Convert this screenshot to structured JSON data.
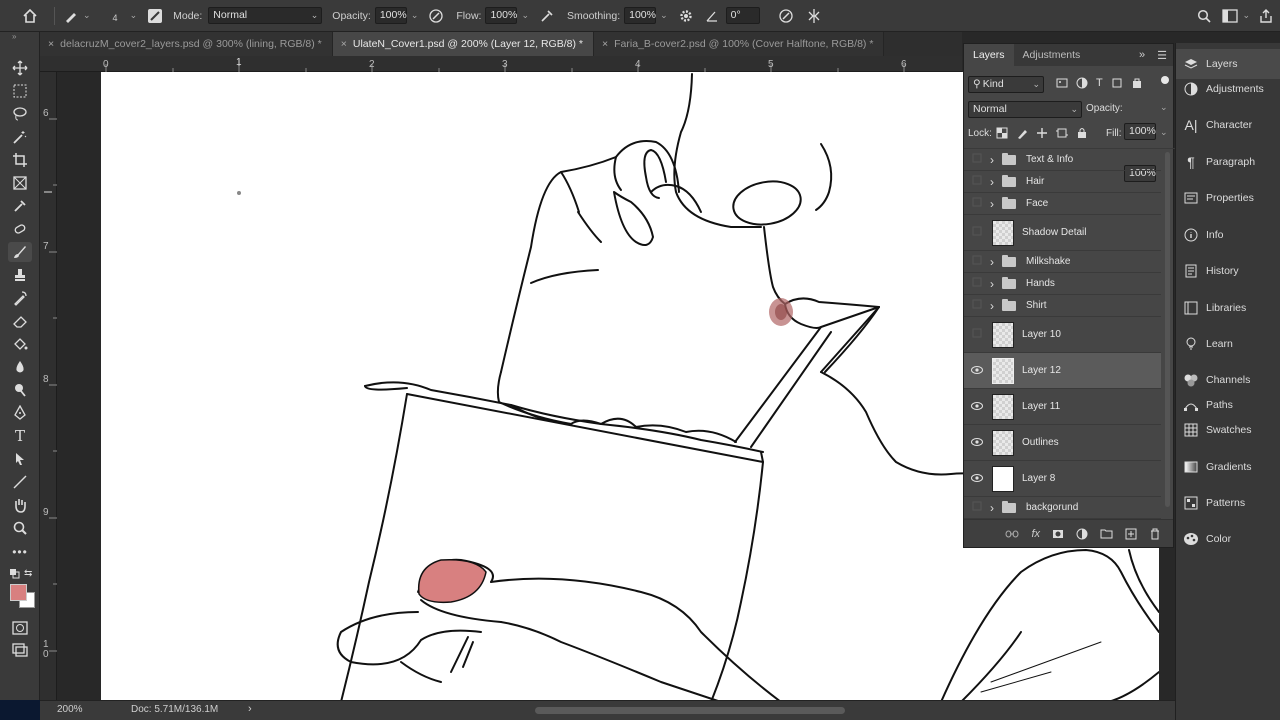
{
  "options_bar": {
    "brush_size": "4",
    "mode_label": "Mode:",
    "mode_value": "Normal",
    "opacity_label": "Opacity:",
    "opacity_value": "100%",
    "flow_label": "Flow:",
    "flow_value": "100%",
    "smoothing_label": "Smoothing:",
    "smoothing_value": "100%",
    "angle_value": "0°"
  },
  "tabs": [
    {
      "label": "delacruzM_cover2_layers.psd @ 300% (lining, RGB/8) *",
      "active": false
    },
    {
      "label": "UlateN_Cover1.psd @ 200% (Layer 12, RGB/8) *",
      "active": true
    },
    {
      "label": "Faria_B-cover2.psd @ 100% (Cover Halftone, RGB/8) *",
      "active": false
    }
  ],
  "ruler": {
    "h": [
      "0",
      "1",
      "2",
      "3",
      "4",
      "5",
      "6"
    ],
    "v": [
      "6",
      "7",
      "8",
      "9",
      "1\n0"
    ]
  },
  "status": {
    "zoom": "200%",
    "doc": "Doc: 5.71M/136.1M",
    "arrow": "›"
  },
  "colors": {
    "foreground": "#d88080",
    "background": "#ffffff",
    "accent_selected_row": "#5b5b5b"
  },
  "layers_panel": {
    "tabs": [
      "Layers",
      "Adjustments"
    ],
    "filter_kind": "Kind",
    "blend_mode": "Normal",
    "opacity_label": "Opacity:",
    "opacity_value": "100%",
    "lock_label": "Lock:",
    "fill_label": "Fill:",
    "fill_value": "100%",
    "layers": [
      {
        "name": "Text & Info",
        "type": "folder",
        "visible": false
      },
      {
        "name": "Hair",
        "type": "folder",
        "visible": false
      },
      {
        "name": "Face",
        "type": "folder",
        "visible": false
      },
      {
        "name": "Shadow Detail",
        "type": "layer",
        "visible": false
      },
      {
        "name": "Milkshake",
        "type": "folder",
        "visible": false
      },
      {
        "name": "Hands",
        "type": "folder",
        "visible": false
      },
      {
        "name": "Shirt",
        "type": "folder",
        "visible": false
      },
      {
        "name": "Layer 10",
        "type": "layer",
        "visible": false
      },
      {
        "name": "Layer 12",
        "type": "layer",
        "visible": true,
        "selected": true
      },
      {
        "name": "Layer 11",
        "type": "layer",
        "visible": true
      },
      {
        "name": "Outlines",
        "type": "layer",
        "visible": true
      },
      {
        "name": "Layer 8",
        "type": "white",
        "visible": true
      },
      {
        "name": "backgorund",
        "type": "folder",
        "visible": false
      }
    ]
  },
  "dock": [
    {
      "label": "Layers",
      "icon": "layers-icon",
      "active": true
    },
    {
      "label": "Adjustments",
      "icon": "adjustments-icon"
    },
    {
      "label": "Character",
      "icon": "character-icon"
    },
    {
      "label": "Paragraph",
      "icon": "paragraph-icon"
    },
    {
      "label": "Properties",
      "icon": "properties-icon"
    },
    {
      "label": "Info",
      "icon": "info-icon"
    },
    {
      "label": "History",
      "icon": "history-icon"
    },
    {
      "label": "Libraries",
      "icon": "libraries-icon"
    },
    {
      "label": "Learn",
      "icon": "learn-icon"
    },
    {
      "label": "Channels",
      "icon": "channels-icon"
    },
    {
      "label": "Paths",
      "icon": "paths-icon"
    },
    {
      "label": "Swatches",
      "icon": "swatches-icon"
    },
    {
      "label": "Gradients",
      "icon": "gradients-icon"
    },
    {
      "label": "Patterns",
      "icon": "patterns-icon"
    },
    {
      "label": "Color",
      "icon": "color-icon"
    }
  ]
}
